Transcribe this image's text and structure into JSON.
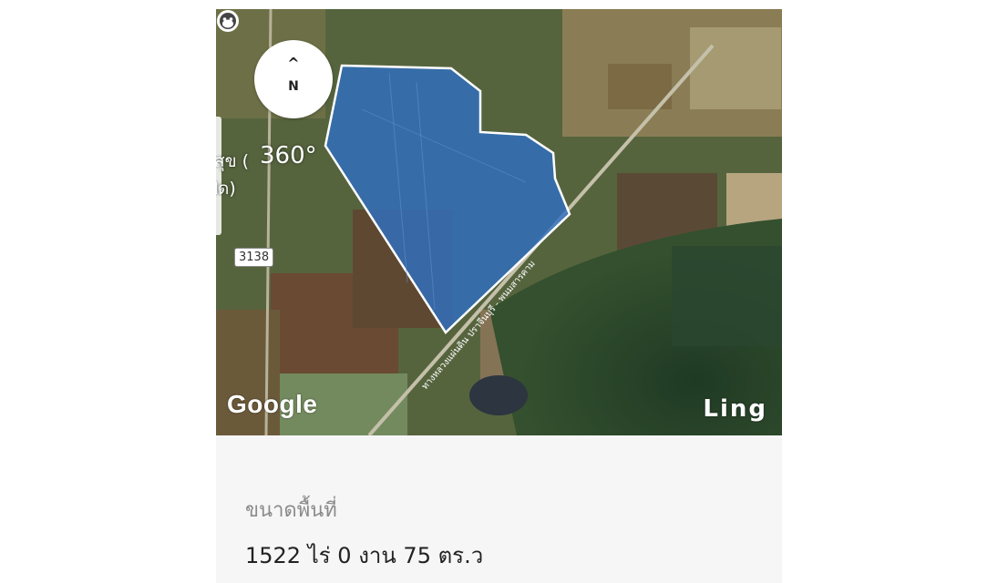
{
  "map": {
    "compass": {
      "arrow": "^",
      "direction": "N"
    },
    "view_360_label": "360°",
    "place_label_fragment_1": "สุข (",
    "place_label_fragment_2": "ปิด)",
    "road_number": "3138",
    "road_name": "ทางหลวงแผ่นดิน ปราจีนบุรี - พนมสารคาม",
    "attribution": "Google",
    "brand": "Ling",
    "brand_icon": "monkey-face-icon",
    "colors": {
      "parcel_fill": "#2f6fc0",
      "parcel_outline": "#ffffff"
    }
  },
  "info": {
    "area_label": "ขนาดพื้นที่",
    "area_value": "1522 ไร่ 0 งาน 75 ตร.ว"
  }
}
